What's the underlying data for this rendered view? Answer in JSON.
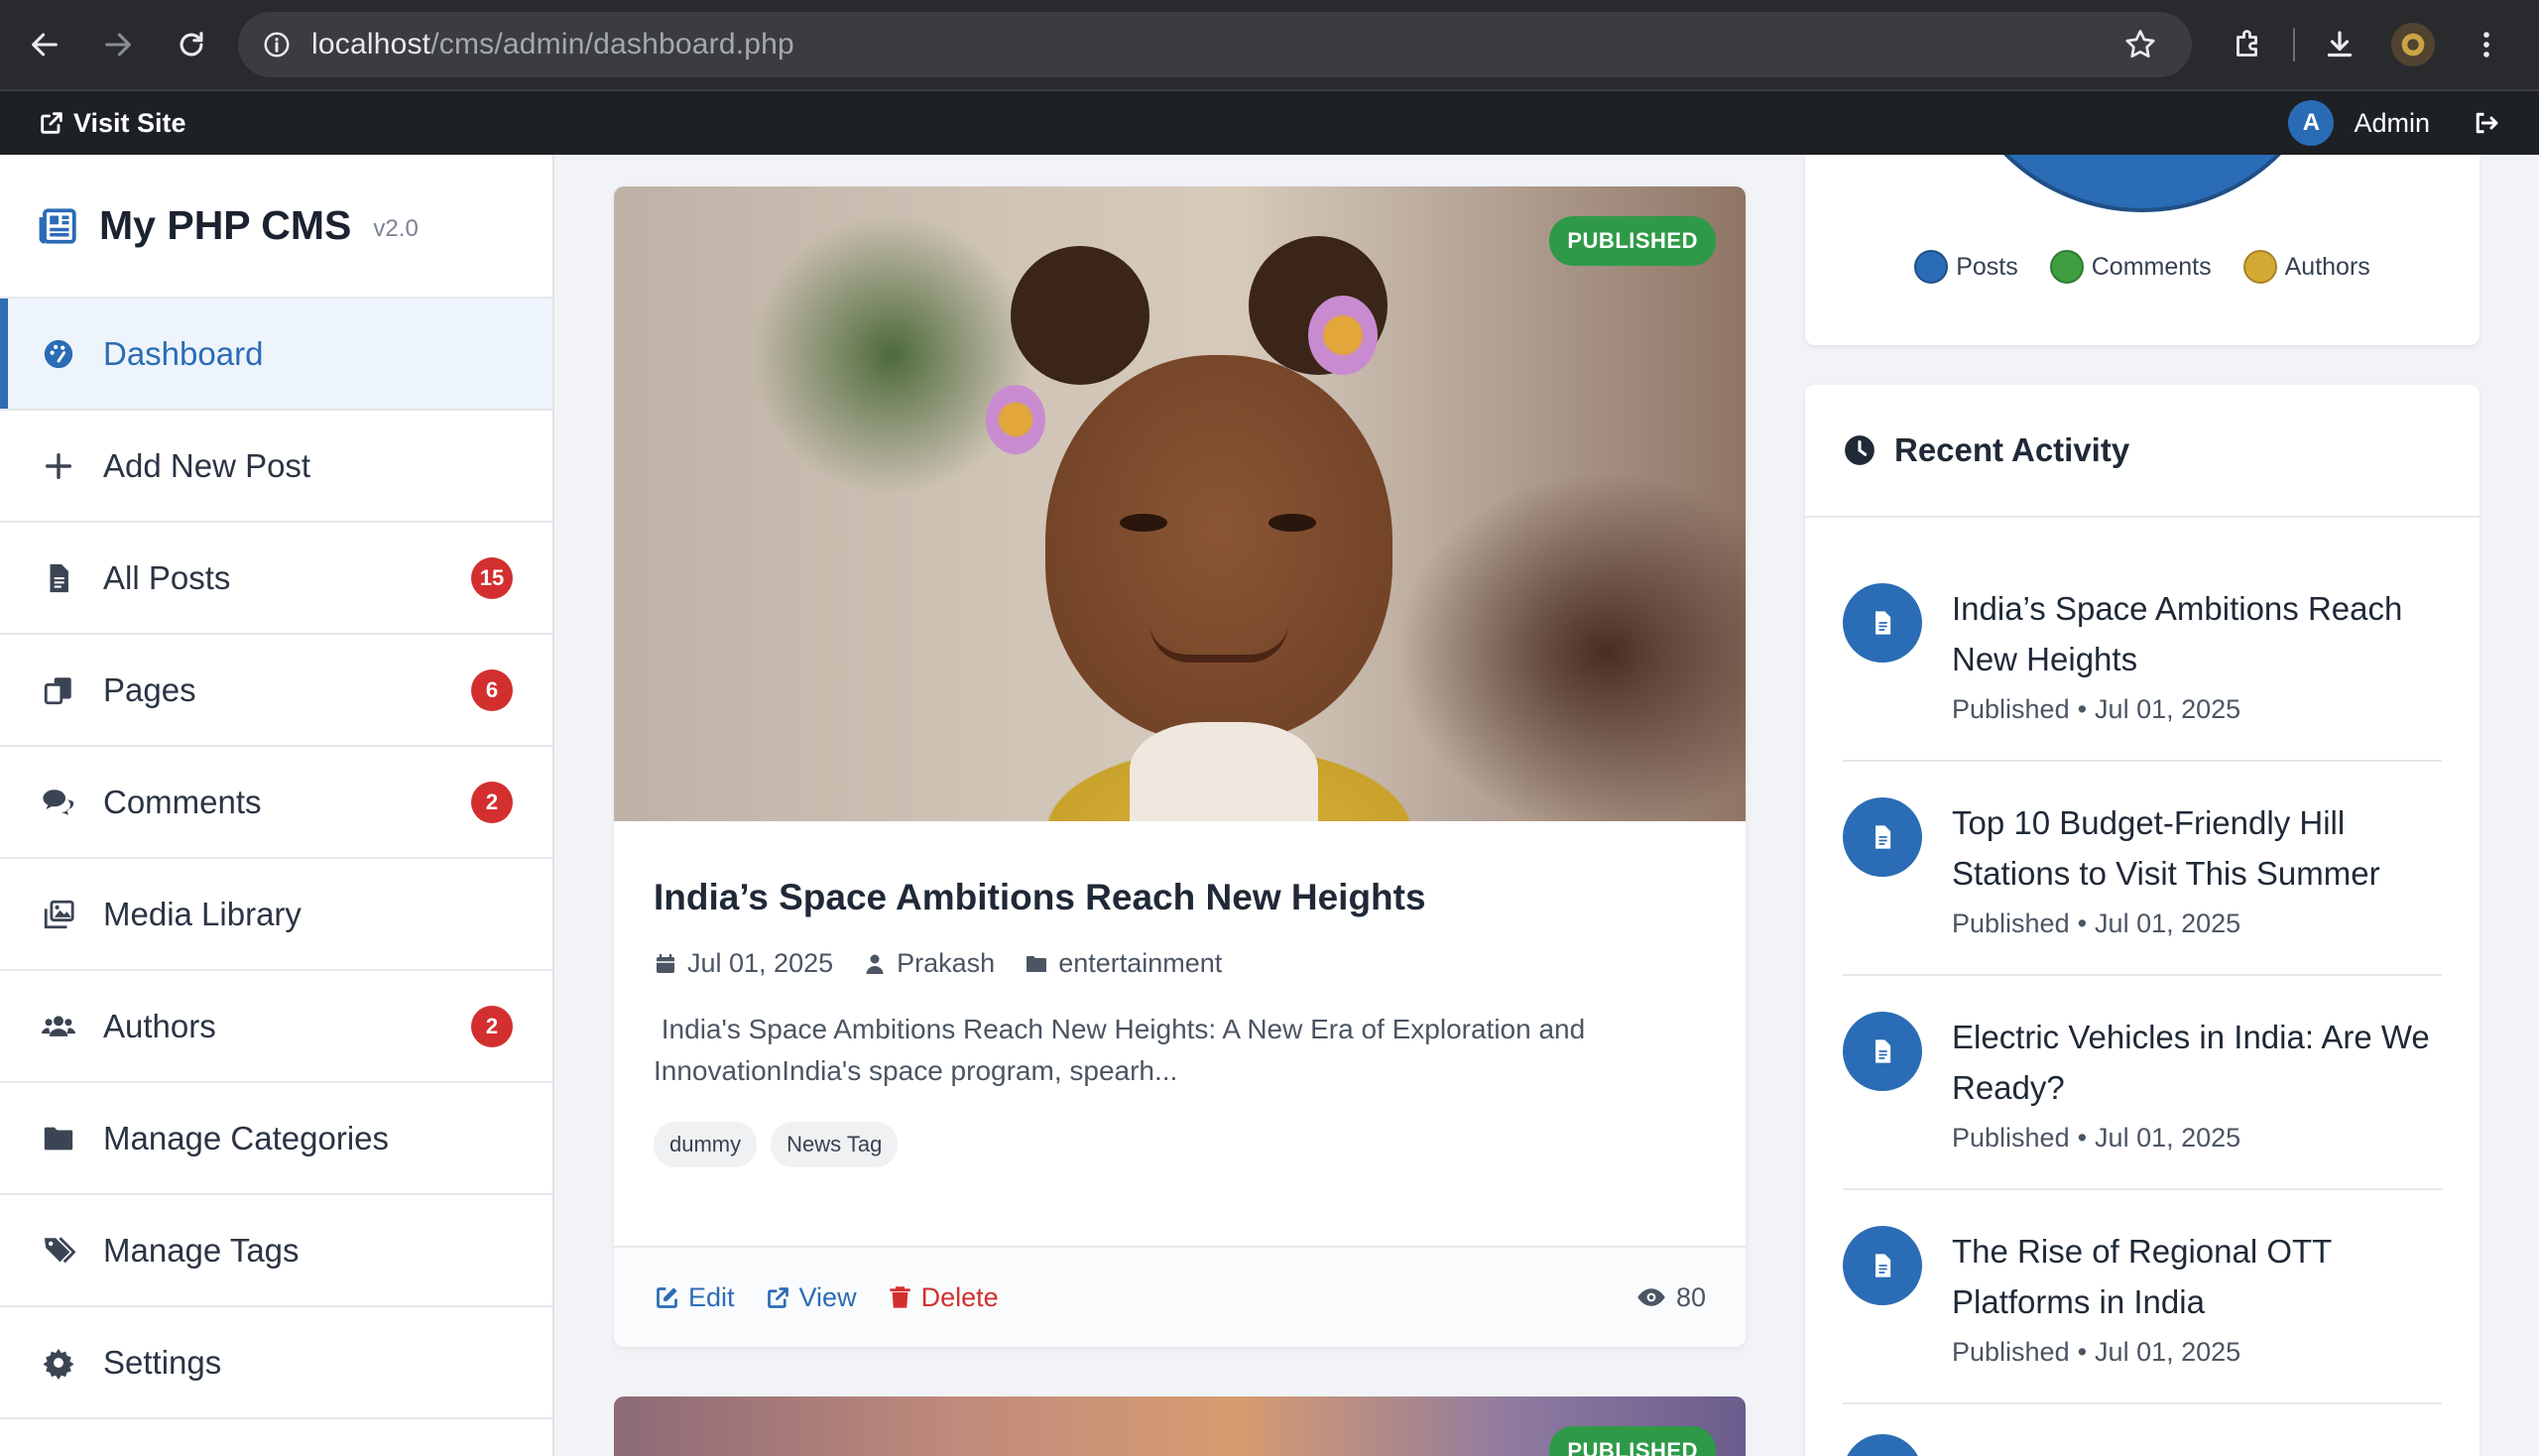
{
  "browser": {
    "url_host": "localhost",
    "url_path": "/cms/admin/dashboard.php"
  },
  "adminbar": {
    "visit_label": "Visit Site",
    "avatar_letter": "A",
    "user_name": "Admin"
  },
  "sidebar": {
    "brand": "My PHP CMS",
    "version": "v2.0",
    "items": [
      {
        "label": "Dashboard",
        "icon": "palette-icon",
        "active": true
      },
      {
        "label": "Add New Post",
        "icon": "plus-icon"
      },
      {
        "label": "All Posts",
        "icon": "file-icon",
        "badge": "15"
      },
      {
        "label": "Pages",
        "icon": "copy-icon",
        "badge": "6"
      },
      {
        "label": "Comments",
        "icon": "comments-icon",
        "badge": "2"
      },
      {
        "label": "Media Library",
        "icon": "images-icon"
      },
      {
        "label": "Authors",
        "icon": "users-icon",
        "badge": "2"
      },
      {
        "label": "Manage Categories",
        "icon": "folder-icon"
      },
      {
        "label": "Manage Tags",
        "icon": "tags-icon"
      },
      {
        "label": "Settings",
        "icon": "gear-icon"
      }
    ]
  },
  "post": {
    "status": "PUBLISHED",
    "title": "India’s Space Ambitions Reach New Heights",
    "date": "Jul 01, 2025",
    "author": "Prakash",
    "category": "entertainment",
    "excerpt": " India's Space Ambitions Reach New Heights: A New Era of Exploration and InnovationIndia's space program, spearh...",
    "tags": [
      "dummy",
      "News Tag"
    ],
    "actions": {
      "edit": "Edit",
      "view": "View",
      "delete": "Delete"
    },
    "views": "80"
  },
  "post2": {
    "status": "PUBLISHED"
  },
  "chart_data": {
    "type": "pie",
    "legend": [
      "Posts",
      "Comments",
      "Authors"
    ],
    "colors": [
      "#2a6cb5",
      "#3e9e40",
      "#d4a933"
    ]
  },
  "activity": {
    "title": "Recent Activity",
    "items": [
      {
        "title": "India’s Space Ambitions Reach New Heights",
        "status": "Published",
        "date": "Jul 01, 2025"
      },
      {
        "title": "Top 10 Budget-Friendly Hill Stations to Visit This Summer",
        "status": "Published",
        "date": "Jul 01, 2025"
      },
      {
        "title": "Electric Vehicles in India: Are We Ready?",
        "status": "Published",
        "date": "Jul 01, 2025"
      },
      {
        "title": "The Rise of Regional OTT Platforms in India",
        "status": "Published",
        "date": "Jul 01, 2025"
      }
    ]
  }
}
